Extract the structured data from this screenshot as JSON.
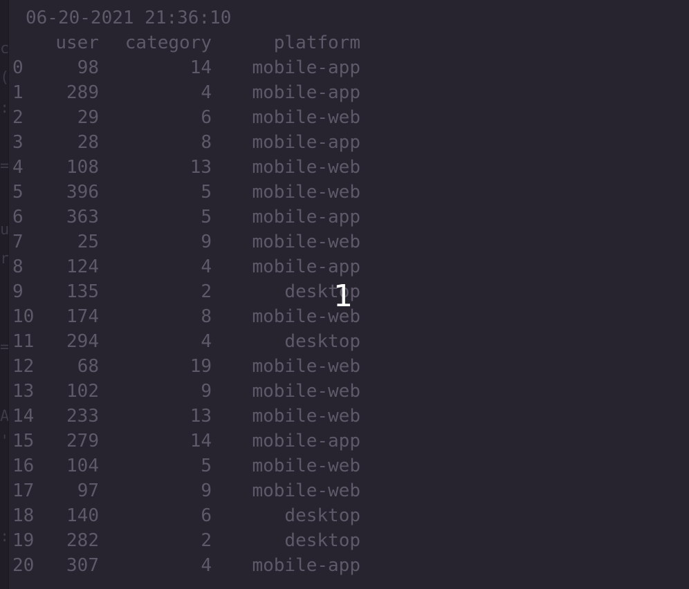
{
  "terminal": {
    "timestamp": "06-20-2021 21:36:10",
    "columns": [
      "user",
      "category",
      "platform"
    ],
    "rows": [
      {
        "idx": "0",
        "user": "98",
        "category": "14",
        "platform": "mobile-app"
      },
      {
        "idx": "1",
        "user": "289",
        "category": "4",
        "platform": "mobile-app"
      },
      {
        "idx": "2",
        "user": "29",
        "category": "6",
        "platform": "mobile-web"
      },
      {
        "idx": "3",
        "user": "28",
        "category": "8",
        "platform": "mobile-app"
      },
      {
        "idx": "4",
        "user": "108",
        "category": "13",
        "platform": "mobile-web"
      },
      {
        "idx": "5",
        "user": "396",
        "category": "5",
        "platform": "mobile-web"
      },
      {
        "idx": "6",
        "user": "363",
        "category": "5",
        "platform": "mobile-app"
      },
      {
        "idx": "7",
        "user": "25",
        "category": "9",
        "platform": "mobile-web"
      },
      {
        "idx": "8",
        "user": "124",
        "category": "4",
        "platform": "mobile-app"
      },
      {
        "idx": "9",
        "user": "135",
        "category": "2",
        "platform": "desktop"
      },
      {
        "idx": "10",
        "user": "174",
        "category": "8",
        "platform": "mobile-web"
      },
      {
        "idx": "11",
        "user": "294",
        "category": "4",
        "platform": "desktop"
      },
      {
        "idx": "12",
        "user": "68",
        "category": "19",
        "platform": "mobile-web"
      },
      {
        "idx": "13",
        "user": "102",
        "category": "9",
        "platform": "mobile-web"
      },
      {
        "idx": "14",
        "user": "233",
        "category": "13",
        "platform": "mobile-web"
      },
      {
        "idx": "15",
        "user": "279",
        "category": "14",
        "platform": "mobile-app"
      },
      {
        "idx": "16",
        "user": "104",
        "category": "5",
        "platform": "mobile-web"
      },
      {
        "idx": "17",
        "user": "97",
        "category": "9",
        "platform": "mobile-web"
      },
      {
        "idx": "18",
        "user": "140",
        "category": "6",
        "platform": "desktop"
      },
      {
        "idx": "19",
        "user": "282",
        "category": "2",
        "platform": "desktop"
      },
      {
        "idx": "20",
        "user": "307",
        "category": "4",
        "platform": "mobile-app"
      }
    ]
  },
  "overlay": {
    "number": "1"
  },
  "colors": {
    "background": "#27232f",
    "text": "#5f5a69",
    "overlay_text": "#ffffff"
  }
}
